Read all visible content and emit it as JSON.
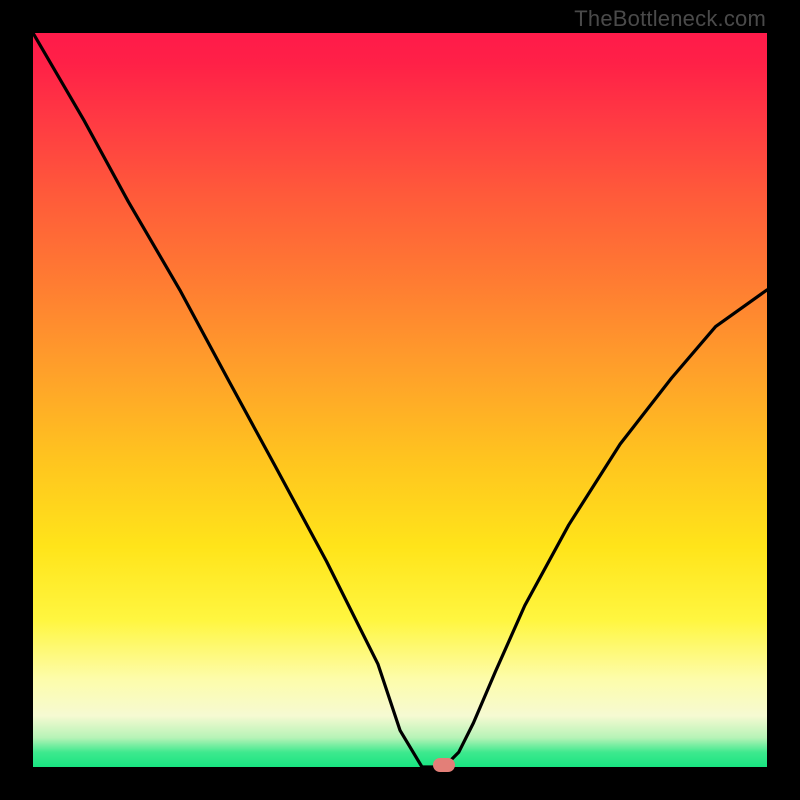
{
  "watermark": {
    "text": "TheBottleneck.com"
  },
  "chart_data": {
    "type": "line",
    "title": "",
    "xlabel": "",
    "ylabel": "",
    "xlim": [
      0,
      100
    ],
    "ylim": [
      0,
      100
    ],
    "grid": false,
    "series": [
      {
        "name": "bottleneck-curve",
        "x": [
          0,
          7,
          13,
          20,
          27,
          33,
          40,
          47,
          50,
          53,
          55,
          56,
          58,
          60,
          63,
          67,
          73,
          80,
          87,
          93,
          100
        ],
        "values": [
          100,
          88,
          77,
          65,
          52,
          41,
          28,
          14,
          5,
          0,
          0,
          0,
          2,
          6,
          13,
          22,
          33,
          44,
          53,
          60,
          65
        ]
      }
    ],
    "marker": {
      "x": 56,
      "y": 0,
      "color": "#e37f78"
    },
    "background_gradient": {
      "stops": [
        {
          "pos": 0,
          "color": "#ff1b4a"
        },
        {
          "pos": 22,
          "color": "#ff5a3a"
        },
        {
          "pos": 46,
          "color": "#ffa02a"
        },
        {
          "pos": 70,
          "color": "#ffe41a"
        },
        {
          "pos": 88,
          "color": "#fdfcaa"
        },
        {
          "pos": 96,
          "color": "#b7f3b7"
        },
        {
          "pos": 100,
          "color": "#18e481"
        }
      ]
    }
  }
}
